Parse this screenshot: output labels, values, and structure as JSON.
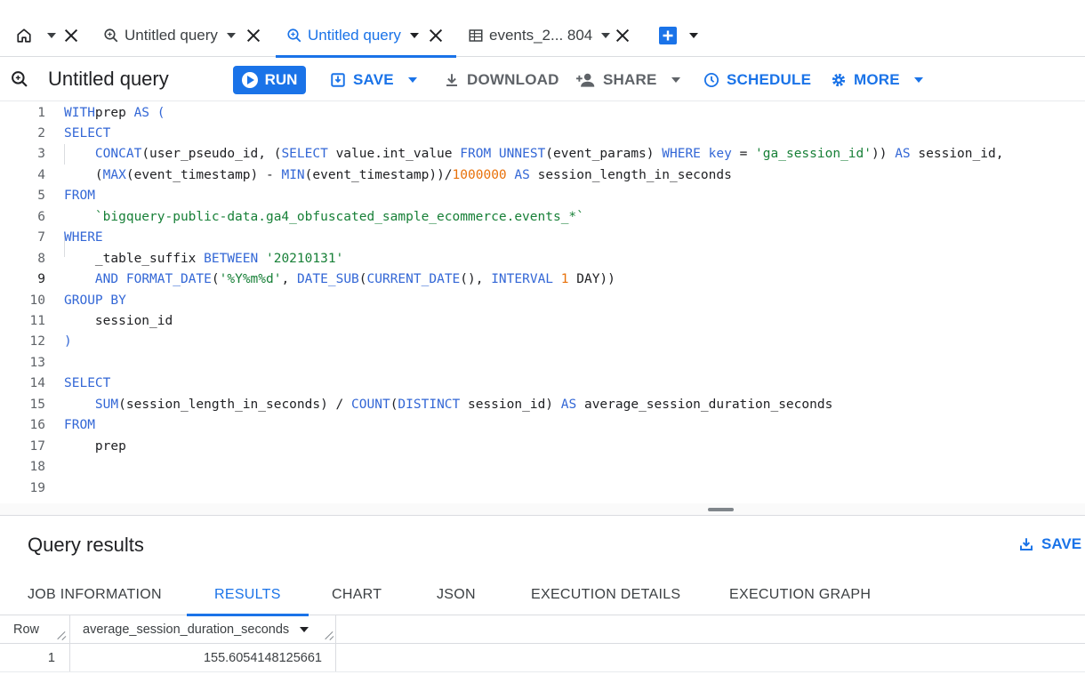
{
  "tabs": [
    {
      "label": "Untitled query",
      "active": false
    },
    {
      "label": "Untitled query",
      "active": true
    },
    {
      "label": "events_2... 804",
      "active": false
    }
  ],
  "toolbar": {
    "title": "Untitled query",
    "run_label": "RUN",
    "save_label": "SAVE",
    "download_label": "DOWNLOAD",
    "share_label": "SHARE",
    "schedule_label": "SCHEDULE",
    "more_label": "MORE"
  },
  "editor": {
    "lines": [
      {
        "n": "1",
        "tokens": [
          [
            "kw",
            "WITH"
          ],
          [
            "",
            "prep "
          ],
          [
            "kw",
            "AS"
          ],
          [
            "kw",
            " ("
          ]
        ]
      },
      {
        "n": "2",
        "tokens": [
          [
            "kw",
            "SELECT"
          ]
        ]
      },
      {
        "n": "3",
        "tokens": [
          [
            "",
            "    "
          ],
          [
            "kw",
            "CONCAT"
          ],
          [
            "",
            "(user_pseudo_id, ("
          ],
          [
            "kw",
            "SELECT"
          ],
          [
            "",
            " value.int_value "
          ],
          [
            "kw",
            "FROM"
          ],
          [
            "",
            " "
          ],
          [
            "kw",
            "UNNEST"
          ],
          [
            "",
            "(event_params) "
          ],
          [
            "kw",
            "WHERE"
          ],
          [
            "",
            " "
          ],
          [
            "kw",
            "key"
          ],
          [
            "",
            " = "
          ],
          [
            "str",
            "'ga_session_id'"
          ],
          [
            "",
            "))"
          ],
          [
            "",
            " "
          ],
          [
            "kw",
            "AS"
          ],
          [
            "",
            " session_id,"
          ]
        ]
      },
      {
        "n": "4",
        "tokens": [
          [
            "",
            "    ("
          ],
          [
            "kw",
            "MAX"
          ],
          [
            "",
            "(event_timestamp) - "
          ],
          [
            "kw",
            "MIN"
          ],
          [
            "",
            "(event_timestamp))/"
          ],
          [
            "num",
            "1000000"
          ],
          [
            "",
            " "
          ],
          [
            "kw",
            "AS"
          ],
          [
            "",
            " session_length_in_seconds"
          ]
        ]
      },
      {
        "n": "5",
        "tokens": [
          [
            "kw",
            "FROM"
          ]
        ]
      },
      {
        "n": "6",
        "tokens": [
          [
            "",
            "    "
          ],
          [
            "str",
            "`bigquery-public-data.ga4_obfuscated_sample_ecommerce.events_*`"
          ]
        ]
      },
      {
        "n": "7",
        "tokens": [
          [
            "kw",
            "WHERE"
          ]
        ]
      },
      {
        "n": "8",
        "tokens": [
          [
            "",
            "    _table_suffix "
          ],
          [
            "kw",
            "BETWEEN"
          ],
          [
            "",
            " "
          ],
          [
            "str",
            "'20210131'"
          ]
        ]
      },
      {
        "n": "9",
        "tokens": [
          [
            "",
            "    "
          ],
          [
            "kw",
            "AND"
          ],
          [
            "",
            " "
          ],
          [
            "kw",
            "FORMAT_DATE"
          ],
          [
            "",
            "("
          ],
          [
            "str",
            "'%Y%m%d'"
          ],
          [
            "",
            ", "
          ],
          [
            "kw",
            "DATE_SUB"
          ],
          [
            "",
            "("
          ],
          [
            "kw",
            "CURRENT_DATE"
          ],
          [
            "",
            "(), "
          ],
          [
            "kw",
            "INTERVAL"
          ],
          [
            "",
            " "
          ],
          [
            "num",
            "1"
          ],
          [
            "",
            " DAY))"
          ]
        ]
      },
      {
        "n": "10",
        "tokens": [
          [
            "kw",
            "GROUP BY"
          ]
        ]
      },
      {
        "n": "11",
        "tokens": [
          [
            "",
            "    session_id"
          ]
        ]
      },
      {
        "n": "12",
        "tokens": [
          [
            "kw",
            ")"
          ]
        ]
      },
      {
        "n": "13",
        "tokens": []
      },
      {
        "n": "14",
        "tokens": [
          [
            "kw",
            "SELECT"
          ]
        ]
      },
      {
        "n": "15",
        "tokens": [
          [
            "",
            "    "
          ],
          [
            "kw",
            "SUM"
          ],
          [
            "",
            "(session_length_in_seconds) / "
          ],
          [
            "kw",
            "COUNT"
          ],
          [
            "",
            "("
          ],
          [
            "kw",
            "DISTINCT"
          ],
          [
            "",
            " session_id) "
          ],
          [
            "kw",
            "AS"
          ],
          [
            "",
            " average_session_duration_seconds"
          ]
        ]
      },
      {
        "n": "16",
        "tokens": [
          [
            "kw",
            "FROM"
          ]
        ]
      },
      {
        "n": "17",
        "tokens": [
          [
            "",
            "    prep"
          ]
        ]
      },
      {
        "n": "18",
        "tokens": []
      },
      {
        "n": "19",
        "tokens": []
      }
    ]
  },
  "results": {
    "title": "Query results",
    "save_label": "SAVE R",
    "tabs": [
      "JOB INFORMATION",
      "RESULTS",
      "CHART",
      "JSON",
      "EXECUTION DETAILS",
      "EXECUTION GRAPH"
    ],
    "active_tab": "RESULTS",
    "columns": [
      "Row",
      "average_session_duration_seconds"
    ],
    "rows": [
      [
        "1",
        "155.6054148125661"
      ]
    ]
  },
  "colors": {
    "accent": "#1a73e8",
    "keyword": "#3367d6",
    "string": "#188038",
    "number": "#e8710a"
  }
}
